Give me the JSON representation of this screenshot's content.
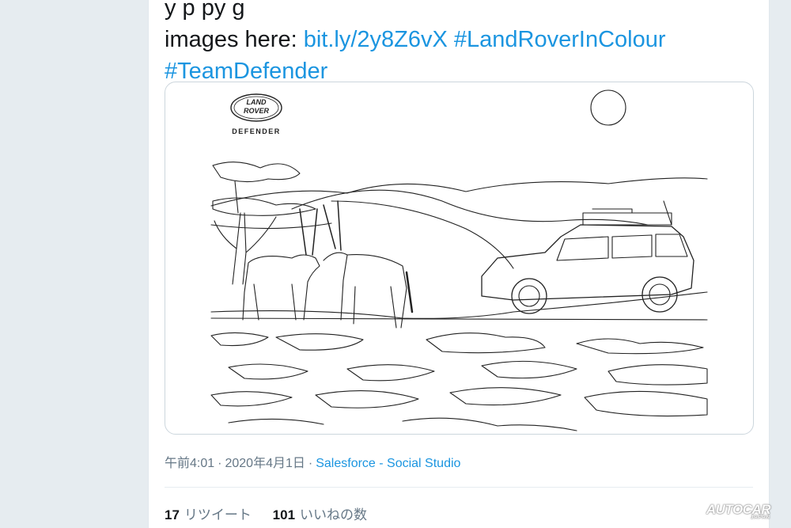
{
  "tweet": {
    "text_line1_partial": "y    p                                               py                          g",
    "text_line2_prefix": "images here: ",
    "link": "bit.ly/2y8Z6vX",
    "hashtag1": "#LandRoverInColour",
    "hashtag2": "#TeamDefender"
  },
  "media": {
    "logo_top": "LAND",
    "logo_bottom": "ROVER",
    "brand_model": "DEFENDER"
  },
  "meta": {
    "time": "午前4:01",
    "separator": "·",
    "date": "2020年4月1日",
    "source": "Salesforce - Social Studio"
  },
  "stats": {
    "retweets_count": "17",
    "retweets_label": "リツイート",
    "likes_count": "101",
    "likes_label": "いいねの数"
  },
  "watermark": {
    "brand": "AUTOCAR",
    "sub": "JAPAN"
  },
  "colors": {
    "link": "#1b95e0",
    "text": "#14171a",
    "muted": "#657786",
    "background": "#e6ecf0"
  }
}
